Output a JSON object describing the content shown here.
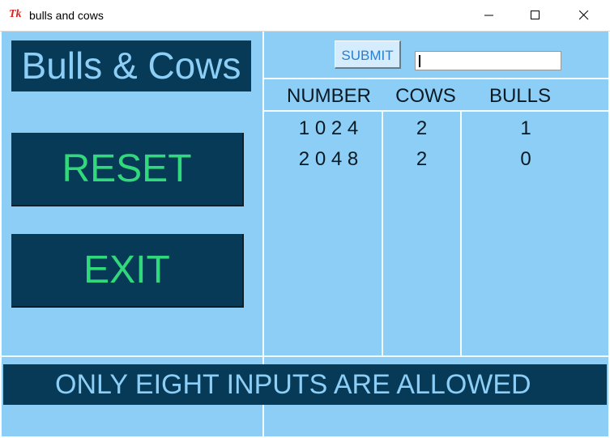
{
  "window": {
    "title": "bulls and cows",
    "icon_glyph": "Tk",
    "icon": "tk-feather-icon",
    "controls": [
      "minimize-icon",
      "maximize-icon",
      "close-icon"
    ]
  },
  "logo": {
    "text": "Bulls & Cows"
  },
  "buttons": {
    "reset": "RESET",
    "exit": "EXIT",
    "submit": "SUBMIT"
  },
  "guess_input": {
    "value": ""
  },
  "table": {
    "headers": [
      "NUMBER",
      "COWS",
      "BULLS"
    ],
    "rows": [
      {
        "number": "1 0 2 4",
        "cows": "2",
        "bulls": "1"
      },
      {
        "number": "2 0 4 8",
        "cows": "2",
        "bulls": "0"
      }
    ]
  },
  "status": {
    "message": "ONLY EIGHT INPUTS ARE ALLOWED"
  },
  "colors": {
    "background": "#8ccef6",
    "panel_dark": "#063a56",
    "button_text": "#31d97c",
    "light_text": "#8ccef6"
  }
}
